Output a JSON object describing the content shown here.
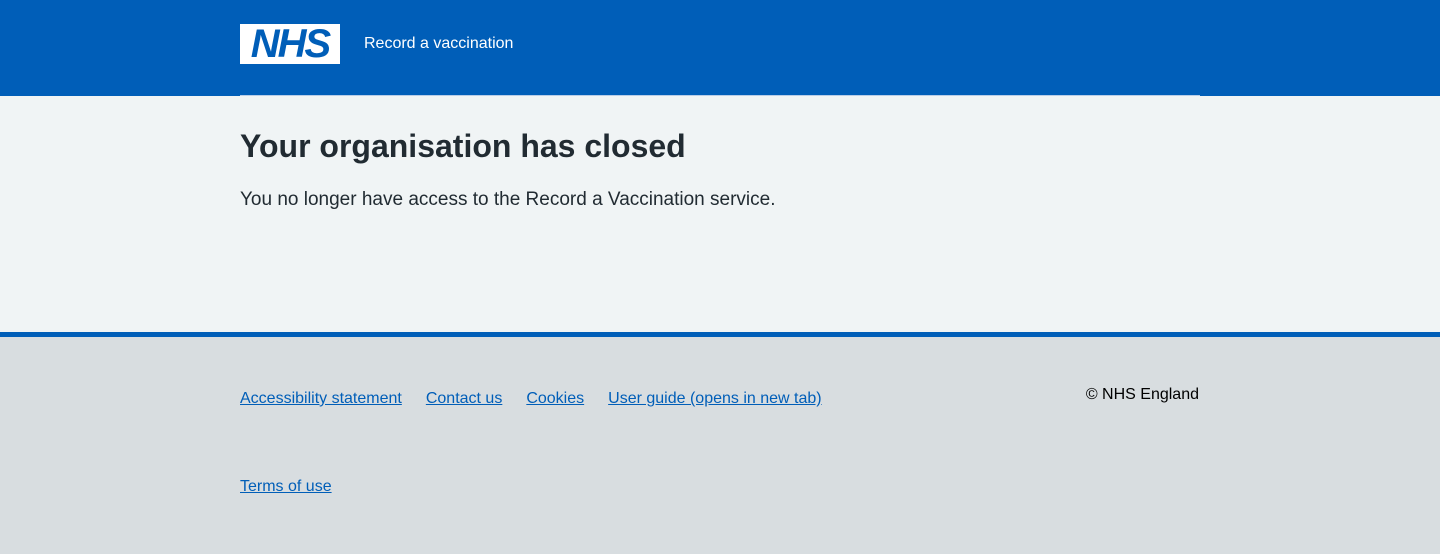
{
  "header": {
    "logo_text": "NHS",
    "service_name": "Record a vaccination"
  },
  "main": {
    "title": "Your organisation has closed",
    "body": "You no longer have access to the Record a Vaccination service."
  },
  "footer": {
    "links": [
      "Accessibility statement",
      "Contact us",
      "Cookies",
      "User guide (opens in new tab)",
      "Terms of use"
    ],
    "copyright": "© NHS England"
  },
  "colors": {
    "nhs_blue": "#005eb8",
    "page_background": "#f0f4f5",
    "footer_background": "#d8dde0",
    "text": "#212b32"
  }
}
